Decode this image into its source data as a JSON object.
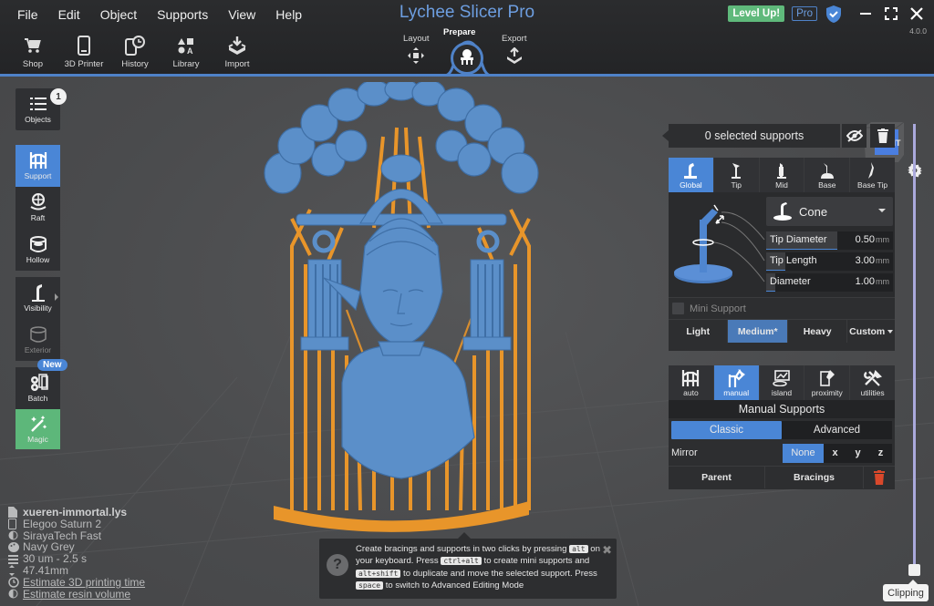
{
  "app": {
    "title": "Lychee Slicer Pro",
    "version": "4.0.0"
  },
  "menu": [
    "File",
    "Edit",
    "Object",
    "Supports",
    "View",
    "Help"
  ],
  "toolbar": [
    {
      "label": "Shop",
      "icon": "cart-icon"
    },
    {
      "label": "3D Printer",
      "icon": "printer-icon"
    },
    {
      "label": "History",
      "icon": "history-icon"
    },
    {
      "label": "Library",
      "icon": "library-icon"
    },
    {
      "label": "Import",
      "icon": "import-icon"
    }
  ],
  "modes": {
    "layout": "Layout",
    "prepare": "Prepare",
    "export": "Export",
    "active": "Prepare"
  },
  "header_right": {
    "level_up": "Level Up!",
    "pro": "Pro"
  },
  "viewcube": {
    "face": "FRONT"
  },
  "sidebar": {
    "objects": {
      "label": "Objects",
      "count": "1"
    },
    "items": [
      {
        "label": "Support",
        "active": true
      },
      {
        "label": "Raft"
      },
      {
        "label": "Hollow"
      },
      {
        "label": "Visibility"
      },
      {
        "label": "Exterior",
        "disabled": true
      },
      {
        "label": "Batch",
        "badge": "New"
      },
      {
        "label": "Magic"
      }
    ]
  },
  "info": {
    "file": "xueren-immortal.lys",
    "printer": "Elegoo Saturn 2",
    "resin": "SirayaTech Fast",
    "color": "Navy Grey",
    "layer": "30 um - 2.5 s",
    "height": "47.41mm",
    "estimate_time": "Estimate 3D printing time",
    "estimate_resin": "Estimate resin volume"
  },
  "hint": {
    "p1": "Create bracings and supports in two clicks by pressing",
    "k1": "alt",
    "p2": "on your keyboard. Press",
    "k2": "ctrl+alt",
    "p3": "to create mini supports and",
    "k3": "alt+shift",
    "p4": "to duplicate and move the selected support. Press",
    "k4": "space",
    "p5": "to switch to Advanced Editing Mode",
    "close": "✖",
    "qmark": "?"
  },
  "supports_panel": {
    "selected": "0 selected supports",
    "tabs": [
      "Global",
      "Tip",
      "Mid",
      "Base",
      "Base Tip"
    ],
    "active_tab": "Global",
    "shape": "Cone",
    "params": [
      {
        "name": "Tip Diameter",
        "value": "0.50",
        "unit": "mm",
        "fill": 0.56
      },
      {
        "name": "Tip Length",
        "value": "3.00",
        "unit": "mm",
        "fill": 0.15
      },
      {
        "name": "Diameter",
        "value": "1.00",
        "unit": "mm",
        "fill": 0.07
      }
    ],
    "mini_support": "Mini Support",
    "density": [
      "Light",
      "Medium*",
      "Heavy",
      "Custom"
    ],
    "active_density": "Medium*"
  },
  "tools_panel": {
    "tabs": [
      "auto",
      "manual",
      "island",
      "proximity",
      "utilities"
    ],
    "active_tab": "manual",
    "title": "Manual Supports",
    "modes": [
      "Classic",
      "Advanced"
    ],
    "active_mode": "Classic",
    "mirror_label": "Mirror",
    "mirror_opts": [
      "None",
      "x",
      "y",
      "z"
    ],
    "parent": "Parent",
    "bracings": "Bracings"
  },
  "clipping": {
    "label": "Clipping",
    "value": 1.0
  },
  "colors": {
    "accent": "#4a86d6",
    "title": "#6d9ee0",
    "magic": "#5db77a",
    "support": "#e8952a",
    "model": "#5b8fc9",
    "delete": "#d9482b"
  }
}
